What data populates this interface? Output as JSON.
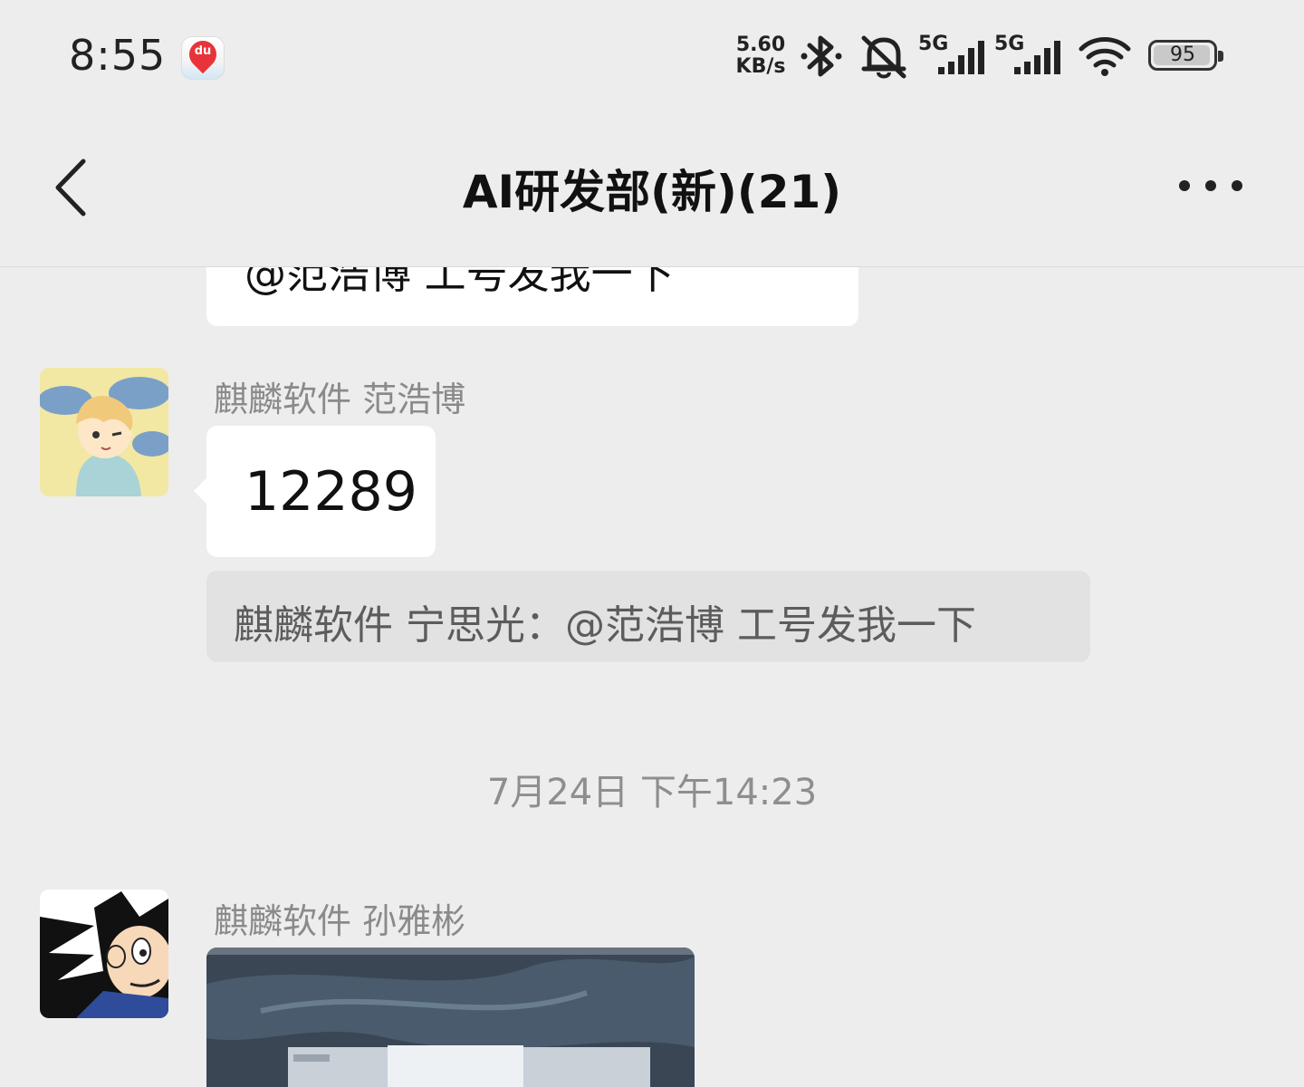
{
  "status_bar": {
    "time": "8:55",
    "app_icon_text": "du",
    "net_speed_value": "5.60",
    "net_speed_unit": "KB/s",
    "signal1_label": "5G",
    "signal2_label": "5G",
    "battery_level": "95",
    "icons": [
      "baidu-maps-icon",
      "bluetooth-icon",
      "mute-icon",
      "signal-icon",
      "signal-icon",
      "wifi-icon",
      "battery-icon"
    ]
  },
  "nav": {
    "title": "AI研发部(新)(21)",
    "back_icon": "chevron-left-icon",
    "more_icon": "more-icon"
  },
  "messages": {
    "previous_text": "@范浩博 工号发我一下",
    "msg1": {
      "sender": "麒麟软件 范浩博",
      "text": "12289"
    },
    "quote": {
      "text": "麒麟软件 宁思光：@范浩博 工号发我一下"
    },
    "timestamp": "7月24日 下午14:23",
    "msg2": {
      "sender": "麒麟软件 孙雅彬"
    }
  },
  "colors": {
    "background": "#ededed",
    "bubble": "#ffffff",
    "quote_bg": "#e2e2e2",
    "secondary_text": "#8a8a8a"
  }
}
